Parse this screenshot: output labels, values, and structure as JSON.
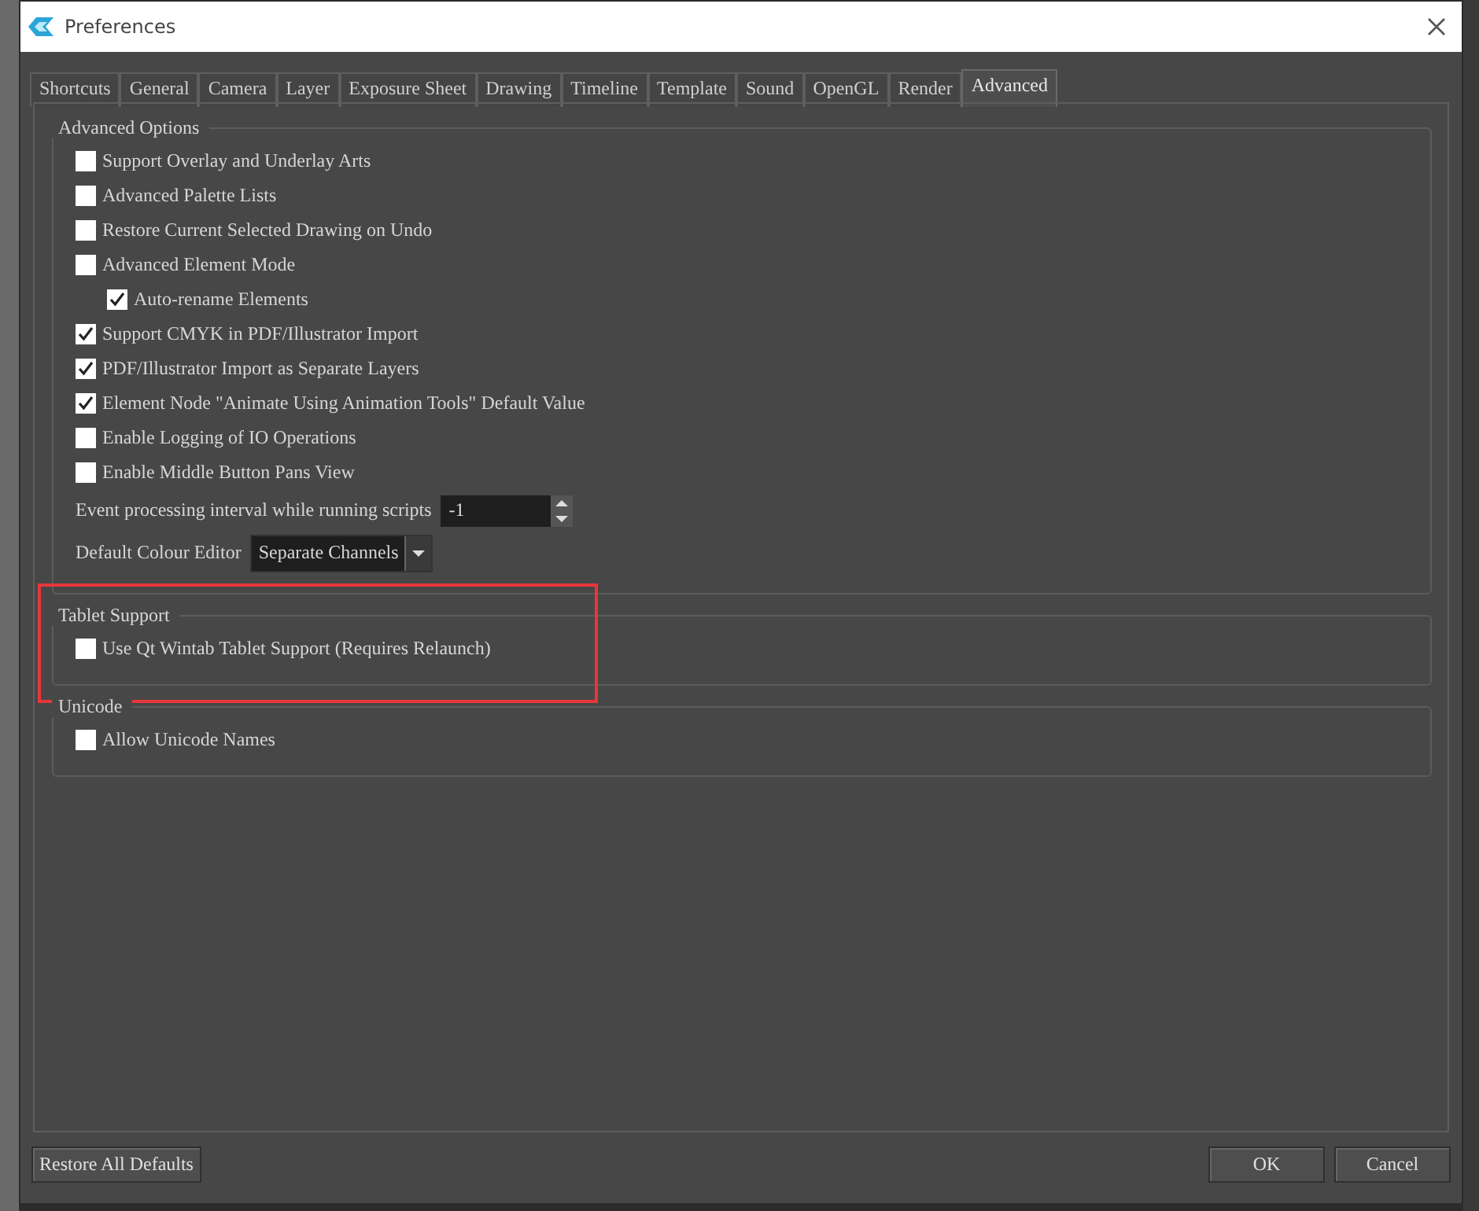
{
  "window": {
    "title": "Preferences"
  },
  "tabs": [
    {
      "label": "Shortcuts",
      "selected": false
    },
    {
      "label": "General",
      "selected": false
    },
    {
      "label": "Camera",
      "selected": false
    },
    {
      "label": "Layer",
      "selected": false
    },
    {
      "label": "Exposure Sheet",
      "selected": false
    },
    {
      "label": "Drawing",
      "selected": false
    },
    {
      "label": "Timeline",
      "selected": false
    },
    {
      "label": "Template",
      "selected": false
    },
    {
      "label": "Sound",
      "selected": false
    },
    {
      "label": "OpenGL",
      "selected": false
    },
    {
      "label": "Render",
      "selected": false
    },
    {
      "label": "Advanced",
      "selected": true
    }
  ],
  "groups": [
    {
      "title": "Advanced Options",
      "highlighted": false,
      "items": [
        {
          "kind": "checkbox",
          "label": "Support Overlay and Underlay Arts",
          "checked": false
        },
        {
          "kind": "checkbox",
          "label": "Advanced Palette Lists",
          "checked": false
        },
        {
          "kind": "checkbox",
          "label": "Restore Current Selected Drawing on Undo",
          "checked": false
        },
        {
          "kind": "checkbox",
          "label": "Advanced Element Mode",
          "checked": false,
          "children": [
            {
              "kind": "checkbox",
              "label": "Auto-rename Elements",
              "checked": true
            }
          ]
        },
        {
          "kind": "checkbox",
          "label": "Support CMYK in PDF/Illustrator Import",
          "checked": true
        },
        {
          "kind": "checkbox",
          "label": "PDF/Illustrator Import as Separate Layers",
          "checked": true
        },
        {
          "kind": "checkbox",
          "label": "Element Node \"Animate Using Animation Tools\" Default Value",
          "checked": true
        },
        {
          "kind": "checkbox",
          "label": "Enable Logging of IO Operations",
          "checked": false
        },
        {
          "kind": "checkbox",
          "label": "Enable Middle Button Pans View",
          "checked": false
        },
        {
          "kind": "spinbox",
          "label": "Event processing interval while running scripts",
          "value": "-1"
        },
        {
          "kind": "combobox",
          "label": "Default Colour Editor",
          "value": "Separate Channels"
        }
      ]
    },
    {
      "title": "Tablet Support",
      "highlighted": true,
      "items": [
        {
          "kind": "checkbox",
          "label": "Use Qt Wintab Tablet Support (Requires Relaunch)",
          "checked": false
        }
      ]
    },
    {
      "title": "Unicode",
      "highlighted": false,
      "items": [
        {
          "kind": "checkbox",
          "label": "Allow Unicode Names",
          "checked": false
        }
      ]
    }
  ],
  "restore_button": "Restore All Defaults",
  "buttons": [
    "OK",
    "Cancel"
  ]
}
